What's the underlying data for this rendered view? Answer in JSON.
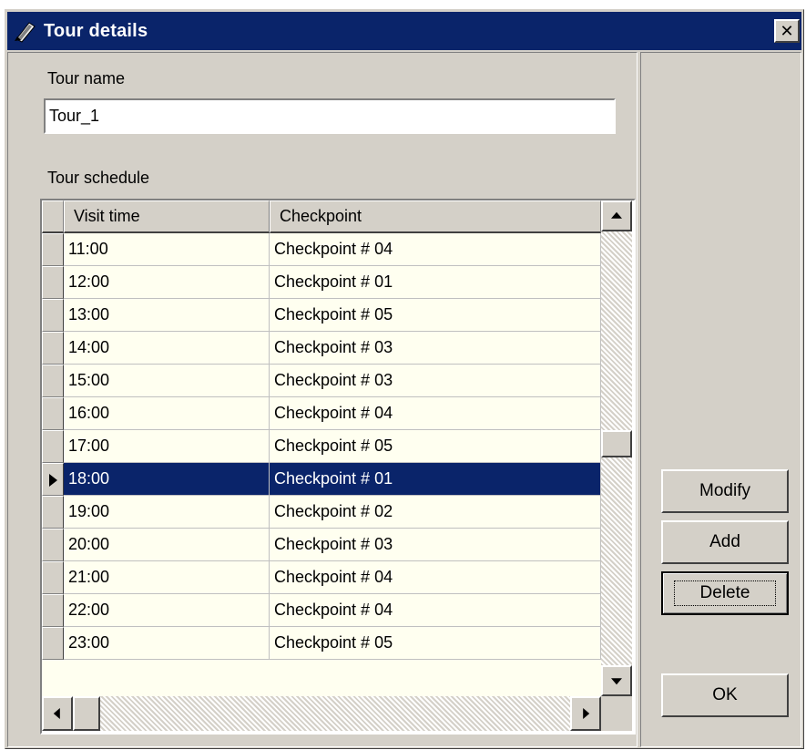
{
  "window": {
    "title": "Tour details",
    "close_glyph": "✕"
  },
  "form": {
    "tour_name_label": "Tour name",
    "tour_name_value": "Tour_1",
    "schedule_label": "Tour schedule"
  },
  "grid": {
    "columns": [
      "Visit time",
      "Checkpoint"
    ],
    "rows": [
      {
        "time": "11:00",
        "checkpoint": "Checkpoint  # 04"
      },
      {
        "time": "12:00",
        "checkpoint": "Checkpoint  # 01"
      },
      {
        "time": "13:00",
        "checkpoint": "Checkpoint  # 05"
      },
      {
        "time": "14:00",
        "checkpoint": "Checkpoint  # 03"
      },
      {
        "time": "15:00",
        "checkpoint": "Checkpoint  # 03"
      },
      {
        "time": "16:00",
        "checkpoint": "Checkpoint  # 04"
      },
      {
        "time": "17:00",
        "checkpoint": "Checkpoint  # 05"
      },
      {
        "time": "18:00",
        "checkpoint": "Checkpoint  # 01"
      },
      {
        "time": "19:00",
        "checkpoint": "Checkpoint  # 02"
      },
      {
        "time": "20:00",
        "checkpoint": "Checkpoint  # 03"
      },
      {
        "time": "21:00",
        "checkpoint": "Checkpoint  # 04"
      },
      {
        "time": "22:00",
        "checkpoint": "Checkpoint  # 04"
      },
      {
        "time": "23:00",
        "checkpoint": "Checkpoint  # 05"
      }
    ],
    "selected_index": 7
  },
  "buttons": {
    "modify": "Modify",
    "add": "Add",
    "delete": "Delete",
    "ok": "OK"
  },
  "icons": {
    "app": "tour-app-icon",
    "close": "close-icon",
    "row_pointer": "row-pointer-icon"
  },
  "colors": {
    "title_bar": "#0a246a",
    "selection": "#0a246a",
    "face": "#d4d0c8",
    "grid_bg": "#fffff0"
  }
}
